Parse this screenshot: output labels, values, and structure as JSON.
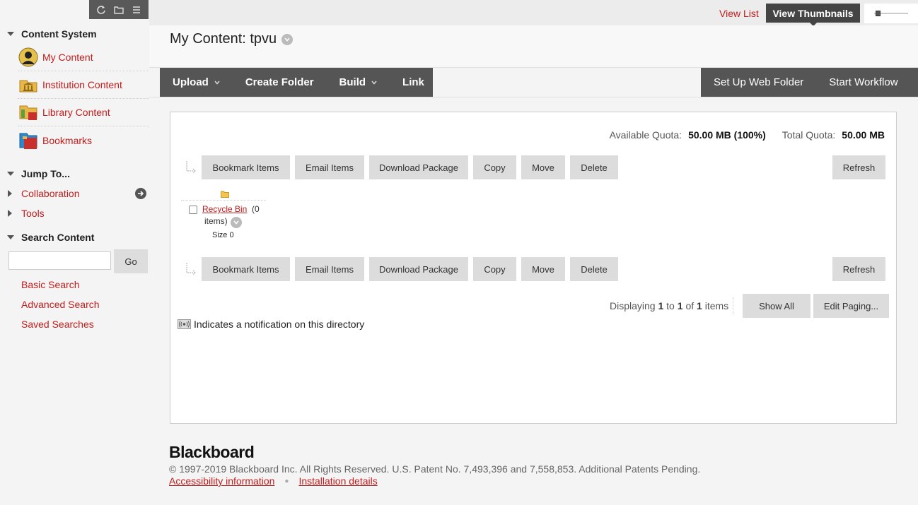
{
  "sidebar": {
    "toolbar": {
      "icons": [
        "refresh-icon",
        "folder-icon",
        "list-icon"
      ]
    },
    "content_system": {
      "heading": "Content System",
      "items": [
        {
          "label": "My Content",
          "icon": "user-avatar-icon"
        },
        {
          "label": "Institution Content",
          "icon": "institution-icon"
        },
        {
          "label": "Library Content",
          "icon": "library-icon"
        },
        {
          "label": "Bookmarks",
          "icon": "bookmarks-icon"
        }
      ]
    },
    "jump_to": {
      "heading": "Jump To...",
      "items": [
        {
          "label": "Collaboration"
        },
        {
          "label": "Tools"
        }
      ]
    },
    "search": {
      "heading": "Search Content",
      "input_value": "",
      "go_label": "Go",
      "links": [
        "Basic Search",
        "Advanced Search",
        "Saved Searches"
      ]
    }
  },
  "view": {
    "list_label": "View List",
    "thumbnails_label": "View Thumbnails",
    "active": "View Thumbnails"
  },
  "page": {
    "title": "My Content: tpvu"
  },
  "action_bar": {
    "left": [
      {
        "label": "Upload",
        "dropdown": true
      },
      {
        "label": "Create Folder",
        "dropdown": false
      },
      {
        "label": "Build",
        "dropdown": true
      },
      {
        "label": "Link",
        "dropdown": false
      }
    ],
    "right": [
      {
        "label": "Set Up Web Folder"
      },
      {
        "label": "Start Workflow"
      }
    ]
  },
  "quota": {
    "available_label": "Available Quota:",
    "available_value": "50.00 MB (100%)",
    "total_label": "Total Quota:",
    "total_value": "50.00 MB"
  },
  "file_actions": {
    "bookmark": "Bookmark Items",
    "email": "Email Items",
    "download": "Download Package",
    "copy": "Copy",
    "move": "Move",
    "delete": "Delete",
    "refresh": "Refresh"
  },
  "item": {
    "name": "Recycle Bin",
    "count_a": "(0",
    "count_b": "items)",
    "size": "Size 0"
  },
  "paging": {
    "prefix": "Displaying",
    "from": "1",
    "to_word": "to",
    "to": "1",
    "of_word": "of",
    "total": "1",
    "suffix": "items",
    "show_all": "Show All",
    "edit_paging": "Edit Paging..."
  },
  "notification_text": "Indicates a notification on this directory",
  "footer": {
    "logo": "Blackboard",
    "copyright": "© 1997-2019 Blackboard Inc. All Rights Reserved. U.S. Patent No. 7,493,396 and 7,558,853. Additional Patents Pending.",
    "links": [
      "Accessibility information",
      "Installation details"
    ]
  },
  "colors": {
    "accent": "#c21c1c",
    "action_bar": "#555555",
    "button_gray": "#dcdcdc"
  }
}
